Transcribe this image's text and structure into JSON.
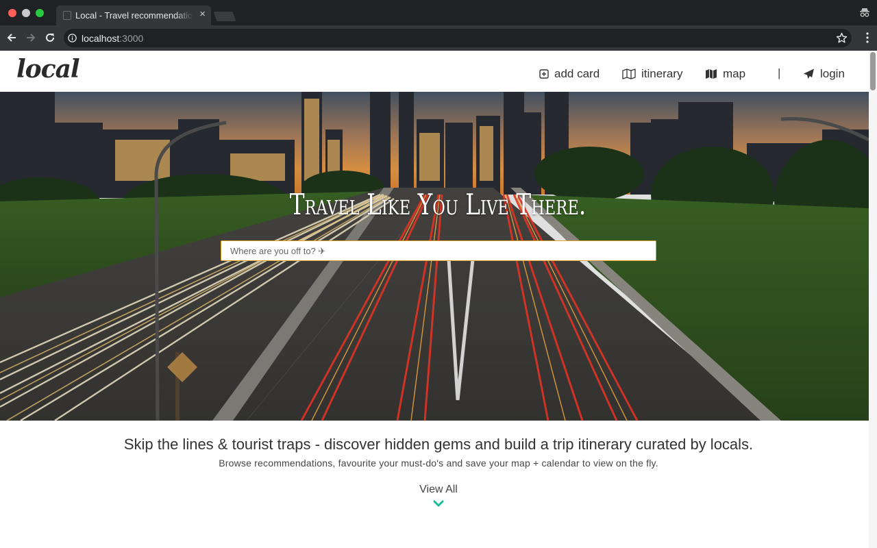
{
  "browser": {
    "tab_title": "Local - Travel recommendations",
    "tab_close": "×",
    "url_host": "localhost",
    "url_port": ":3000"
  },
  "navbar": {
    "logo": "local",
    "items": [
      {
        "label": "add card",
        "icon": "plus-square-icon"
      },
      {
        "label": "itinerary",
        "icon": "map-outline-icon"
      },
      {
        "label": "map",
        "icon": "map-filled-icon"
      }
    ],
    "separator": "|",
    "login": {
      "label": "login",
      "icon": "paper-plane-icon"
    }
  },
  "hero": {
    "tagline": "Travel Like You Live There.",
    "search_placeholder": "Where are you off to? ✈"
  },
  "intro": {
    "headline": "Skip the lines & tourist traps - discover hidden gems and build a trip itinerary curated by locals.",
    "subline": "Browse recommendations, favourite your must-do's and save your map + calendar to view on the fly.",
    "view_all": "View All"
  },
  "colors": {
    "accent": "#1abc9c",
    "search_border": "#e0a32a",
    "text": "#333333"
  }
}
